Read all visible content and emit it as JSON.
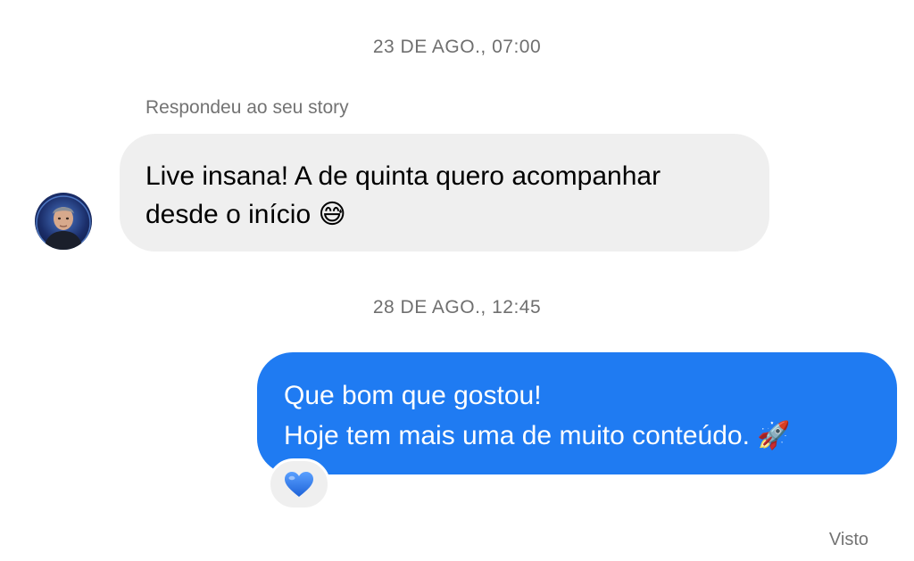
{
  "conversation": {
    "timestamp_1": "23 DE AGO., 07:00",
    "reply_note": "Respondeu ao seu story",
    "incoming_message": {
      "line_1": "Live insana! A de quinta quero acompanhar",
      "line_2": "desde o início",
      "emoji": "😅",
      "emoji_name": "grinning-sweat-emoji"
    },
    "timestamp_2": "28 DE AGO., 12:45",
    "outgoing_message": {
      "line_1": "Que bom que gostou!",
      "line_2": "Hoje tem mais uma de muito conteúdo.",
      "emoji": "🚀",
      "emoji_name": "rocket-emoji"
    },
    "reaction": {
      "emoji": "💙",
      "icon": "blue-heart-icon"
    },
    "status": "Visto"
  },
  "colors": {
    "incoming_bubble": "#efefef",
    "outgoing_bubble": "#1f7bf2",
    "timestamp_text": "#6f6f6f",
    "heart": "#2f7fe8"
  }
}
